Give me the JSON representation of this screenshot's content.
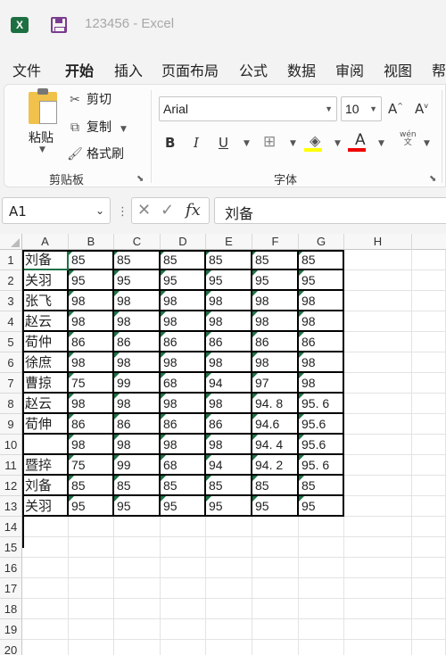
{
  "app": {
    "logo": "X",
    "title": "123456 - Excel"
  },
  "tabs": [
    "文件",
    "开始",
    "插入",
    "页面布局",
    "公式",
    "数据",
    "审阅",
    "视图",
    "帮"
  ],
  "active_tab": "开始",
  "ribbon": {
    "paste": "粘贴",
    "cut": "剪切",
    "copy": "复制",
    "format_painter": "格式刷",
    "clipboard_group": "剪贴板",
    "font_name": "Arial",
    "font_size": "10",
    "bold": "B",
    "italic": "I",
    "underline": "U",
    "font_color_glyph": "A",
    "wen": "wén\n文",
    "font_group": "字体"
  },
  "formula_bar": {
    "cell_ref": "A1",
    "fx": "fx",
    "value": "刘备"
  },
  "columns": [
    "A",
    "B",
    "C",
    "D",
    "E",
    "F",
    "G",
    "H"
  ],
  "rows": [
    [
      "刘备",
      "85",
      "85",
      "85",
      "85",
      "85",
      "85"
    ],
    [
      "关羽",
      "95",
      "95",
      "95",
      "95",
      "95",
      "95"
    ],
    [
      "张飞",
      "98",
      "98",
      "98",
      "98",
      "98",
      "98"
    ],
    [
      "赵云",
      "98",
      "98",
      "98",
      "98",
      "98",
      "98"
    ],
    [
      "荀仲",
      "86",
      "86",
      "86",
      "86",
      "86",
      "86"
    ],
    [
      "徐庶",
      "98",
      "98",
      "98",
      "98",
      "98",
      "98"
    ],
    [
      "曹掠",
      "75",
      "99",
      "68",
      "94",
      "97",
      "98"
    ],
    [
      "赵云",
      "98",
      "98",
      "98",
      "98",
      "94. 8",
      "95. 6"
    ],
    [
      "荀伸",
      "86",
      "86",
      "86",
      "86",
      "94.6",
      "95.6"
    ],
    [
      "",
      "98",
      "98",
      "98",
      "98",
      "94. 4",
      "95.6"
    ],
    [
      "暨捽",
      "75",
      "99",
      "68",
      "94",
      "94. 2",
      "95. 6"
    ],
    [
      "刘备",
      "85",
      "85",
      "85",
      "85",
      "85",
      "85"
    ],
    [
      "关羽",
      "95",
      "95",
      "95",
      "95",
      "95",
      "95"
    ]
  ],
  "row_numbers": [
    "1",
    "2",
    "3",
    "4",
    "5",
    "6",
    "7",
    "8",
    "9",
    "10",
    "11",
    "12",
    "13",
    "14",
    "15",
    "16",
    "17",
    "18",
    "19",
    "20"
  ],
  "colors": {
    "excel_green": "#1d6f42",
    "save_purple": "#7a3d8f",
    "font_red": "#e00000",
    "fill_yellow": "#ffff00"
  }
}
